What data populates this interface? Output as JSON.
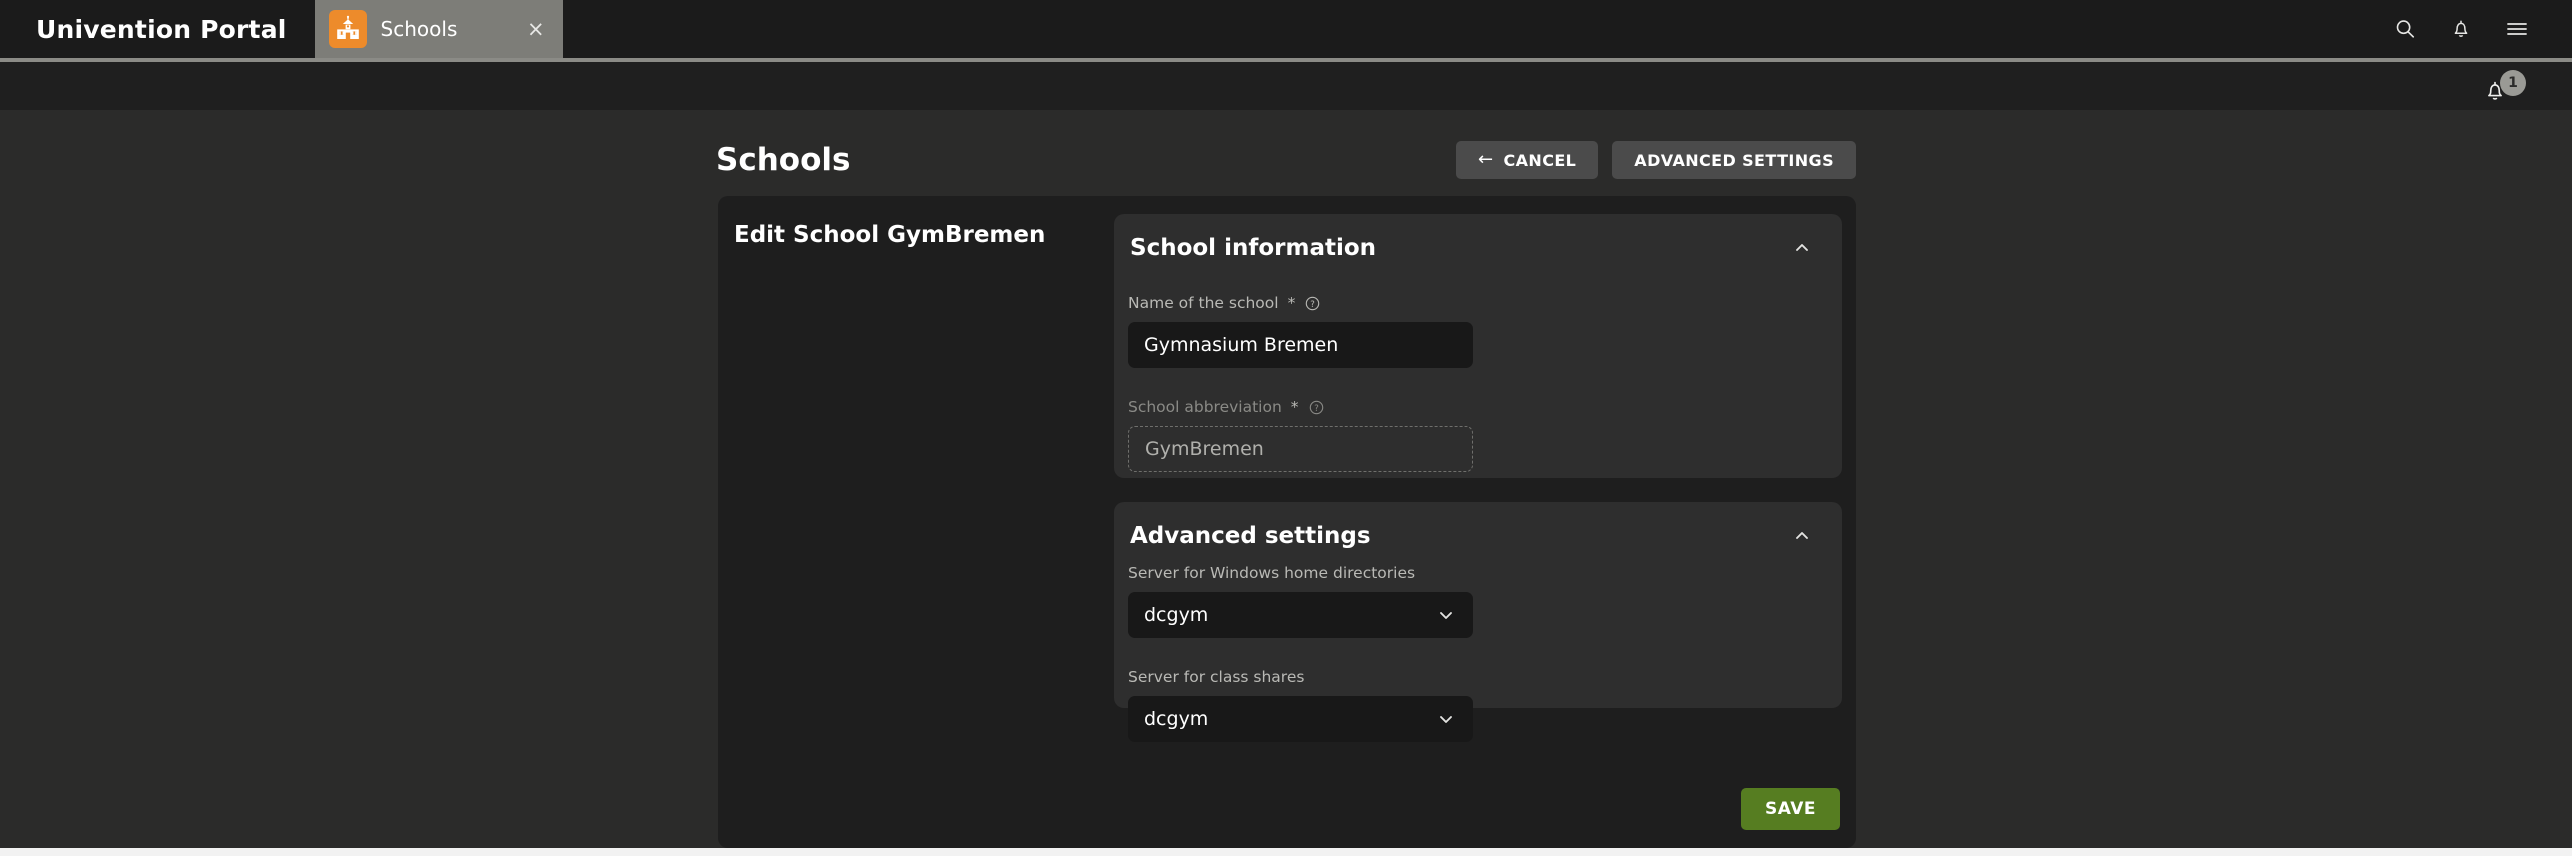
{
  "topbar": {
    "brand": "Univention Portal",
    "tab": {
      "label": "Schools",
      "icon": "school-building-icon",
      "close_label": "×"
    },
    "actions": [
      {
        "name": "search-icon",
        "label": "Search"
      },
      {
        "name": "notifications-icon",
        "label": "Notifications"
      },
      {
        "name": "hamburger-menu-icon",
        "label": "Menu"
      }
    ]
  },
  "subheader": {
    "notification_count": "1"
  },
  "page": {
    "title": "Schools",
    "buttons": {
      "cancel": "CANCEL",
      "cancel_arrow": "←",
      "advanced_settings": "ADVANCED SETTINGS"
    }
  },
  "card": {
    "title": "Edit School GymBremen",
    "save_label": "SAVE"
  },
  "panels": [
    {
      "title": "School information",
      "collapse_state": "expanded",
      "fields": [
        {
          "label": "Name of the school",
          "required": "*",
          "has_help": true,
          "value": "Gymnasium Bremen",
          "type": "text",
          "disabled": false
        },
        {
          "label": "School abbreviation",
          "required": "*",
          "has_help": true,
          "value": "GymBremen",
          "type": "text",
          "disabled": true
        }
      ]
    },
    {
      "title": "Advanced settings",
      "collapse_state": "expanded",
      "fields": [
        {
          "label": "Server for Windows home directories",
          "required": "",
          "has_help": false,
          "value": "dcgym",
          "type": "select",
          "disabled": false
        },
        {
          "label": "Server for class shares",
          "required": "",
          "has_help": false,
          "value": "dcgym",
          "type": "select",
          "disabled": false
        }
      ]
    }
  ],
  "colors": {
    "accent_orange": "#ed8b2b",
    "save_green": "#567d21",
    "topbar_bg": "#1b1b1b",
    "page_bg": "#2b2b2a",
    "card_bg": "#1e1e1e",
    "panel_bg": "#2e2e2e",
    "input_bg": "#181818",
    "tab_bg": "#7d7d78"
  }
}
